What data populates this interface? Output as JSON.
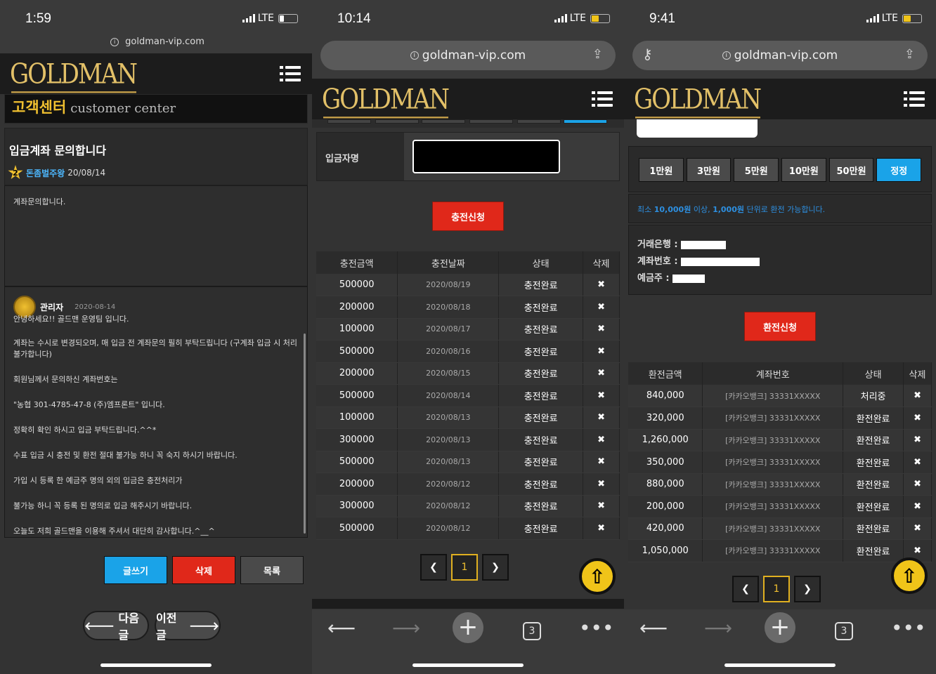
{
  "phone1": {
    "time": "1:59",
    "network": "LTE",
    "url": "goldman-vip.com",
    "logo": "GOLDMAN",
    "section_title": "고객센터",
    "section_sub": "customer center",
    "post_title": "입금계좌 문의합니다",
    "level": "2",
    "author": "돈좀벌주왕",
    "post_date": "20/08/14",
    "post_body": "계좌문의합니다.",
    "reply": {
      "author": "관리자",
      "date": "2020-08-14",
      "lines": [
        "안녕하세요!! 골드맨 운영팀 입니다.",
        "계좌는 수시로 변경되오며, 매 입금 전 계좌문의 필히 부탁드립니다 (구계좌 입금 시 처리 불가합니다)",
        "회원님께서 문의하신 계좌번호는",
        "\"농협 301-4785-47-8 (주)엠프론트\" 입니다.",
        "정확히 확인 하시고 입금 부탁드립니다.^^*",
        "수표 입금 시 충전 및 환전 절대 불가능 하니 꼭 숙지 하시기 바랍니다.",
        "가입 시 등록 한 예금주 명의 외의 입금은 충전처리가",
        "불가능 하니 꼭 등록 된 명의로 입금 해주시기 바랍니다.",
        "오늘도 저희 골드맨을 이용해 주셔서 대단히 감사합니다.^__^"
      ]
    },
    "buttons": {
      "write": "글쓰기",
      "delete": "삭제",
      "list": "목록"
    },
    "nav": {
      "next": "다음글",
      "prev": "이전글"
    }
  },
  "phone2": {
    "time": "10:14",
    "network": "LTE",
    "url": "goldman-vip.com",
    "logo": "GOLDMAN",
    "depositor_label": "입금자명",
    "request_button": "충전신청",
    "columns": [
      "충전금액",
      "충전날짜",
      "상태",
      "삭제"
    ],
    "rows": [
      [
        "500000",
        "2020/08/19",
        "충전완료"
      ],
      [
        "200000",
        "2020/08/18",
        "충전완료"
      ],
      [
        "100000",
        "2020/08/17",
        "충전완료"
      ],
      [
        "500000",
        "2020/08/16",
        "충전완료"
      ],
      [
        "200000",
        "2020/08/15",
        "충전완료"
      ],
      [
        "500000",
        "2020/08/14",
        "충전완료"
      ],
      [
        "100000",
        "2020/08/13",
        "충전완료"
      ],
      [
        "300000",
        "2020/08/13",
        "충전완료"
      ],
      [
        "500000",
        "2020/08/13",
        "충전완료"
      ],
      [
        "200000",
        "2020/08/12",
        "충전완료"
      ],
      [
        "300000",
        "2020/08/12",
        "충전완료"
      ],
      [
        "500000",
        "2020/08/12",
        "충전완료"
      ]
    ],
    "delete_mark": "✖",
    "page": "1",
    "tab_count": "3"
  },
  "phone3": {
    "time": "9:41",
    "network": "LTE",
    "url": "goldman-vip.com",
    "logo": "GOLDMAN",
    "amounts": [
      "1만원",
      "3만원",
      "5만원",
      "10만원",
      "50만원",
      "정정"
    ],
    "notice": {
      "pre": "최소 ",
      "min": "10,000원",
      "mid": " 이상, ",
      "unit": "1,000원",
      "post": " 단위로 환전 가능합니다."
    },
    "bank_labels": {
      "bank": "거래은행 :",
      "account": "계좌번호 :",
      "holder": "예금주 :"
    },
    "request_button": "환전신청",
    "columns": [
      "환전금액",
      "계좌번호",
      "상태",
      "삭제"
    ],
    "rows": [
      [
        "840,000",
        "[카카오뱅크] 33331XXXXX",
        "처리중"
      ],
      [
        "320,000",
        "[카카오뱅크] 33331XXXXX",
        "환전완료"
      ],
      [
        "1,260,000",
        "[카카오뱅크] 33331XXXXX",
        "환전완료"
      ],
      [
        "350,000",
        "[카카오뱅크] 33331XXXXX",
        "환전완료"
      ],
      [
        "880,000",
        "[카카오뱅크] 33331XXXXX",
        "환전완료"
      ],
      [
        "200,000",
        "[카카오뱅크] 33331XXXXX",
        "환전완료"
      ],
      [
        "420,000",
        "[카카오뱅크] 33331XXXXX",
        "환전완료"
      ],
      [
        "1,050,000",
        "[카카오뱅크] 33331XXXXX",
        "환전완료"
      ]
    ],
    "delete_mark": "✖",
    "page": "1",
    "tab_count": "3"
  },
  "colors": {
    "gold": "#e2c068",
    "red": "#e0281a",
    "blue": "#1aa3e8",
    "yellow": "#f0c419"
  }
}
